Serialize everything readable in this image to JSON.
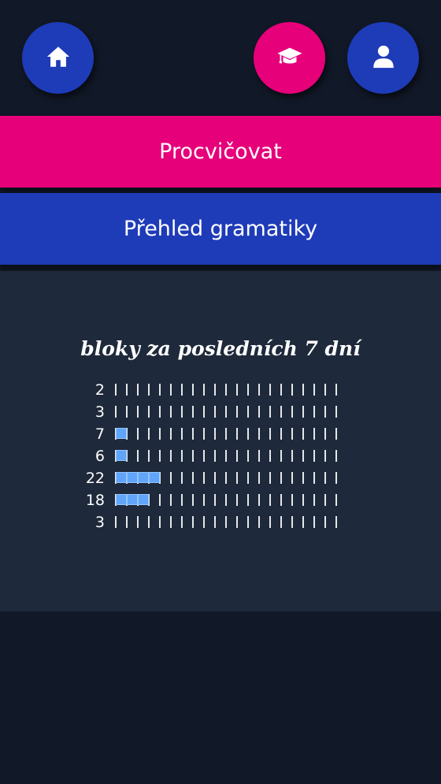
{
  "header": {
    "home_icon": "home-icon",
    "practice_icon": "graduation-cap-icon",
    "profile_icon": "user-icon",
    "home_color": "#1e3bb8",
    "practice_color": "#e6007a",
    "profile_color": "#1e3bb8"
  },
  "menu": {
    "practice_label": "Procvičovat",
    "grammar_label": "Přehled gramatiky",
    "practice_color": "#e6007a",
    "grammar_color": "#1e3bb8"
  },
  "stats": {
    "title": "bloky za posledních 7 dní",
    "ticks_per_row": 21,
    "fill_color": "#60a5fa",
    "rows": [
      {
        "label": "2",
        "filled": 0
      },
      {
        "label": "3",
        "filled": 0
      },
      {
        "label": "7",
        "filled": 1
      },
      {
        "label": "6",
        "filled": 1
      },
      {
        "label": "22",
        "filled": 4
      },
      {
        "label": "18",
        "filled": 3
      },
      {
        "label": "3",
        "filled": 0
      }
    ]
  }
}
